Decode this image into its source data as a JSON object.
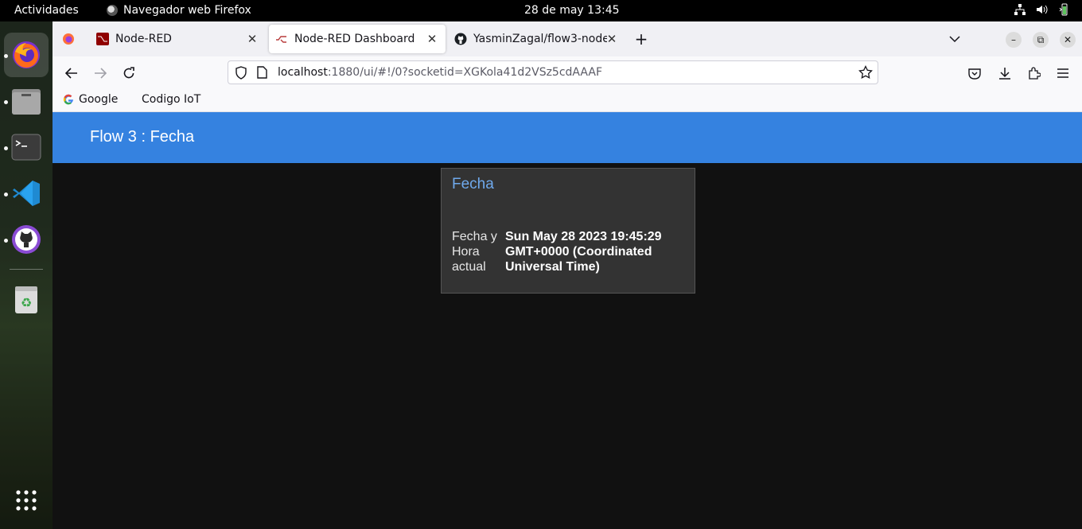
{
  "topbar": {
    "activities": "Actividades",
    "app_name": "Navegador web Firefox",
    "clock": "28 de may  13:45"
  },
  "dock": {
    "items": [
      "firefox-icon",
      "files-icon",
      "terminal-icon",
      "vscode-icon",
      "github-desktop-icon",
      "trash-icon",
      "app-grid-icon"
    ]
  },
  "browser": {
    "tabs": [
      {
        "label": "Node-RED",
        "icon": "node-red-icon"
      },
      {
        "label": "Node-RED Dashboard",
        "icon": "node-red-dashboard-icon",
        "selected": true
      },
      {
        "label": "YasminZagal/flow3-node",
        "icon": "github-icon"
      }
    ],
    "url_host": "localhost",
    "url_path": ":1880/ui/#!/0?socketid=XGKola41d2VSz5cdAAAF",
    "bookmarks": [
      "Google",
      "Codigo IoT"
    ]
  },
  "dashboard": {
    "header_title": "Flow 3 : Fecha",
    "header_color": "#3582e0",
    "card": {
      "title": "Fecha",
      "label": "Fecha y Hora actual",
      "value": "Sun May 28 2023 19:45:29 GMT+0000 (Coordinated Universal Time)"
    }
  }
}
